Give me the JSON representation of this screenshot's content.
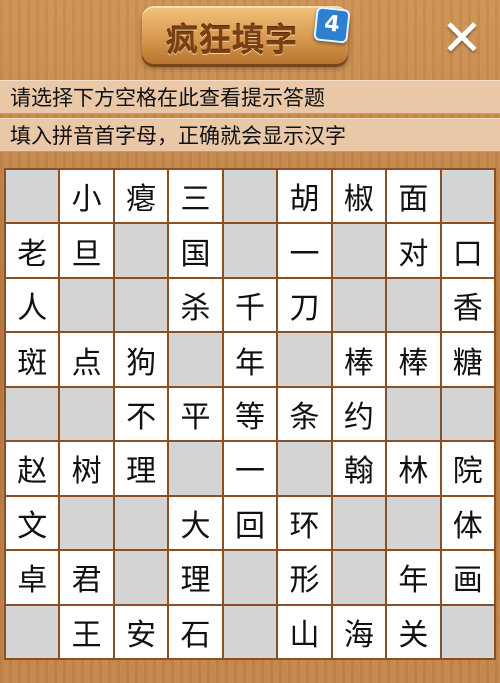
{
  "header": {
    "title": "疯狂填字",
    "badge": "4",
    "close_label": "✕"
  },
  "hints": {
    "line1": "请选择下方空格在此查看提示答题",
    "line2": "填入拼音首字母，正确就会显示汉字"
  },
  "grid": {
    "rows": [
      [
        "",
        "小",
        "瘪",
        "三",
        "",
        "胡",
        "椒",
        "面",
        ""
      ],
      [
        "老",
        "旦",
        "",
        "国",
        "",
        "一",
        "",
        "对",
        "口"
      ],
      [
        "人",
        "",
        "",
        "杀",
        "千",
        "刀",
        "",
        "",
        "香"
      ],
      [
        "斑",
        "点",
        "狗",
        "",
        "年",
        "",
        "棒",
        "棒",
        "糖"
      ],
      [
        "",
        "",
        "不",
        "平",
        "等",
        "条",
        "约",
        "",
        ""
      ],
      [
        "赵",
        "树",
        "理",
        "",
        "一",
        "",
        "翰",
        "林",
        "院"
      ],
      [
        "文",
        "",
        "",
        "大",
        "回",
        "环",
        "",
        "",
        "体"
      ],
      [
        "卓",
        "君",
        "",
        "理",
        "",
        "形",
        "",
        "年",
        "画"
      ],
      [
        "",
        "王",
        "安",
        "石",
        "",
        "山",
        "海",
        "关",
        ""
      ]
    ],
    "blank_cells": [
      [
        0,
        0
      ],
      [
        0,
        4
      ],
      [
        0,
        8
      ],
      [
        1,
        2
      ],
      [
        1,
        4
      ],
      [
        1,
        6
      ],
      [
        2,
        1
      ],
      [
        2,
        2
      ],
      [
        2,
        6
      ],
      [
        2,
        7
      ],
      [
        3,
        3
      ],
      [
        3,
        5
      ],
      [
        4,
        0
      ],
      [
        4,
        1
      ],
      [
        4,
        7
      ],
      [
        4,
        8
      ],
      [
        5,
        3
      ],
      [
        5,
        5
      ],
      [
        6,
        1
      ],
      [
        6,
        2
      ],
      [
        6,
        6
      ],
      [
        6,
        7
      ],
      [
        7,
        2
      ],
      [
        7,
        4
      ],
      [
        7,
        6
      ],
      [
        8,
        0
      ],
      [
        8,
        4
      ],
      [
        8,
        8
      ]
    ]
  },
  "colors": {
    "cell_blank": "#d4d4d4",
    "cell_filled": "#ffffff",
    "grid_line": "#8a4f22",
    "wood": "#c4864a",
    "badge": "#2f7fd0"
  }
}
